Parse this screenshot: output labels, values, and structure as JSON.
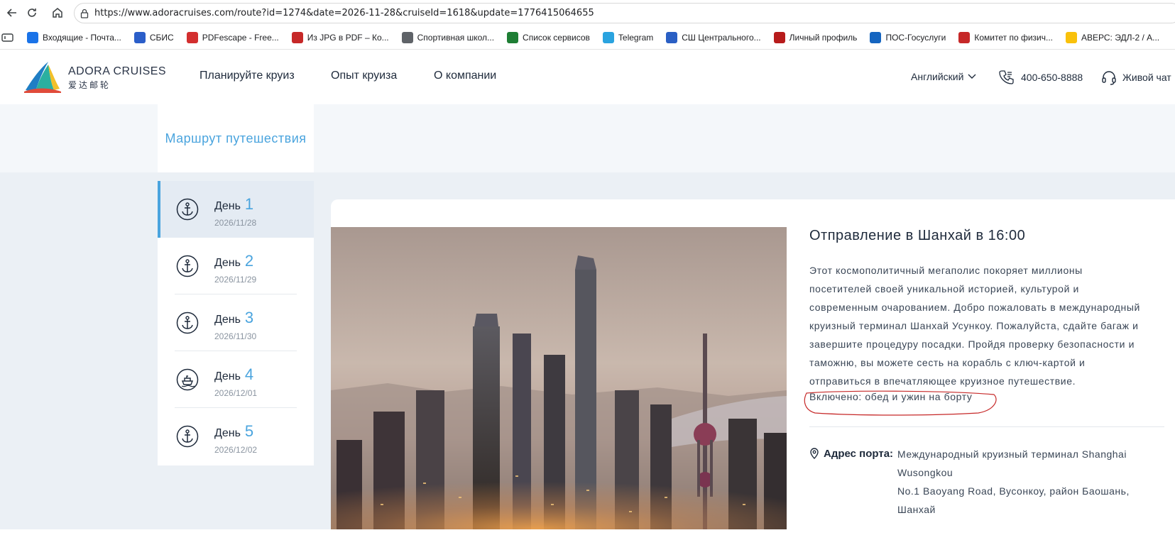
{
  "browser": {
    "url": "https://www.adoracruises.com/route?id=1274&date=2026-11-28&cruiseId=1618&update=1776415064655",
    "bookmarks": [
      {
        "label": "Входящие - Почта...",
        "icon": "mail-icon",
        "color": "#1a73e8"
      },
      {
        "label": "СБИС",
        "icon": "sbis-icon",
        "color": "#2b5ec9"
      },
      {
        "label": "PDFescape - Free...",
        "icon": "pdf-icon",
        "color": "#d32f2f"
      },
      {
        "label": "Из JPG в PDF – Ко...",
        "icon": "jpg-pdf-icon",
        "color": "#c62828"
      },
      {
        "label": "Спортивная школ...",
        "icon": "globe-icon",
        "color": "#5f6368"
      },
      {
        "label": "Список сервисов",
        "icon": "excel-icon",
        "color": "#1e7e34"
      },
      {
        "label": "Telegram",
        "icon": "telegram-icon",
        "color": "#2aa3df"
      },
      {
        "label": "СШ Центрального...",
        "icon": "vk-icon",
        "color": "#2a5fc4"
      },
      {
        "label": "Личный профиль",
        "icon": "crest-icon",
        "color": "#b71c1c"
      },
      {
        "label": "ПОС-Госуслуги",
        "icon": "gosuslugi-icon",
        "color": "#1565c0"
      },
      {
        "label": "Комитет по физич...",
        "icon": "emblem-icon",
        "color": "#c62828"
      },
      {
        "label": "АВЕРС: ЭДЛ-2 / А...",
        "icon": "1c-icon",
        "color": "#f9c10b"
      }
    ]
  },
  "header": {
    "logo_line1": "ADORA CRUISES",
    "logo_line2": "爱达邮轮",
    "nav": [
      "Планируйте круиз",
      "Опыт круиза",
      "О компании"
    ],
    "language": "Английский",
    "phone": "400-650-8888",
    "chat": "Живой чат"
  },
  "sidebar": {
    "title": "Маршрут путешествия",
    "days": [
      {
        "label": "День",
        "num": "1",
        "date": "2026/11/28",
        "icon": "anchor-icon",
        "active": true
      },
      {
        "label": "День",
        "num": "2",
        "date": "2026/11/29",
        "icon": "anchor-icon",
        "active": false
      },
      {
        "label": "День",
        "num": "3",
        "date": "2026/11/30",
        "icon": "anchor-icon",
        "active": false
      },
      {
        "label": "День",
        "num": "4",
        "date": "2026/12/01",
        "icon": "ship-icon",
        "active": false
      },
      {
        "label": "День",
        "num": "5",
        "date": "2026/12/02",
        "icon": "anchor-icon",
        "active": false
      }
    ]
  },
  "detail": {
    "title": "Отправление в Шанхай в 16:00",
    "description_lines": [
      "Этот космополитичный мегаполис покоряет миллионы",
      "посетителей своей уникальной историей, культурой и",
      "современным очарованием. Добро пожаловать в международный",
      "круизный терминал Шанхай Усункоу. Пожалуйста, сдайте багаж и",
      "завершите процедуру посадки. Пройдя проверку безопасности и",
      "таможню, вы можете сесть на корабль с ключ-картой и",
      "отправиться в впечатляющее круизное путешествие."
    ],
    "included": "Включено: обед и ужин на борту",
    "port_label": "Адрес порта:",
    "port_lines": [
      "Международный круизный терминал Shanghai",
      "Wusongkou",
      "No.1 Baoyang Road, Вусонкоу, район Баошань,",
      "Шанхай"
    ],
    "accent_color": "#4aa4de"
  }
}
